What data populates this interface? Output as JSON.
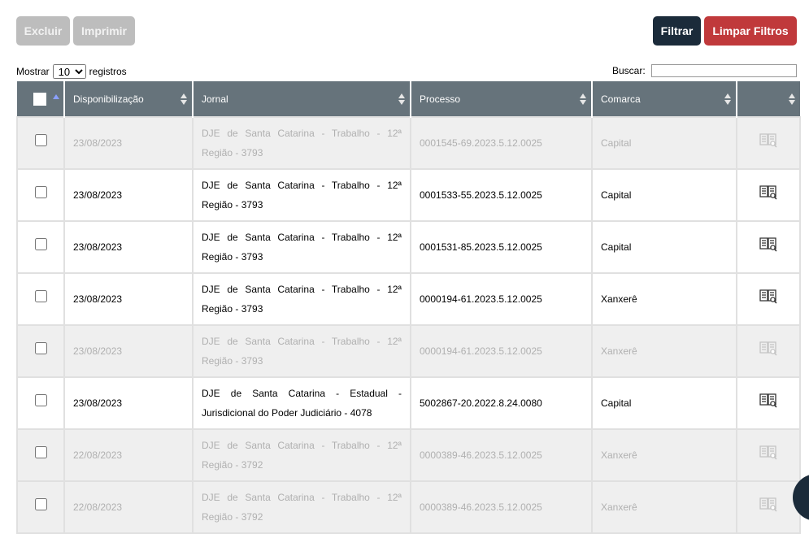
{
  "toolbar": {
    "excluir": "Excluir",
    "imprimir": "Imprimir",
    "filtrar": "Filtrar",
    "limpar": "Limpar Filtros"
  },
  "length": {
    "prefix": "Mostrar",
    "value": "10",
    "suffix": "registros"
  },
  "search": {
    "label": "Buscar:",
    "value": ""
  },
  "table": {
    "headers": [
      "",
      "Disponibilização",
      "Jornal",
      "Processo",
      "Comarca",
      ""
    ],
    "rows": [
      {
        "date": "23/08/2023",
        "jornal": "DJE de Santa Catarina - Trabalho - 12ª Região - 3793",
        "processo": "0001545-69.2023.5.12.0025",
        "comarca": "Capital",
        "dim": true
      },
      {
        "date": "23/08/2023",
        "jornal": "DJE de Santa Catarina - Trabalho - 12ª Região - 3793",
        "processo": "0001533-55.2023.5.12.0025",
        "comarca": "Capital",
        "dim": false
      },
      {
        "date": "23/08/2023",
        "jornal": "DJE de Santa Catarina - Trabalho - 12ª Região - 3793",
        "processo": "0001531-85.2023.5.12.0025",
        "comarca": "Capital",
        "dim": false
      },
      {
        "date": "23/08/2023",
        "jornal": "DJE de Santa Catarina - Trabalho - 12ª Região - 3793",
        "processo": "0000194-61.2023.5.12.0025",
        "comarca": "Xanxerê",
        "dim": false
      },
      {
        "date": "23/08/2023",
        "jornal": "DJE de Santa Catarina - Trabalho - 12ª Região - 3793",
        "processo": "0000194-61.2023.5.12.0025",
        "comarca": "Xanxerê",
        "dim": true
      },
      {
        "date": "23/08/2023",
        "jornal": "DJE de Santa Catarina - Estadual - Jurisdicional do Poder Judiciário - 4078",
        "processo": "5002867-20.2022.8.24.0080",
        "comarca": "Capital",
        "dim": false
      },
      {
        "date": "22/08/2023",
        "jornal": "DJE de Santa Catarina - Trabalho - 12ª Região - 3792",
        "processo": "0000389-46.2023.5.12.0025",
        "comarca": "Xanxerê",
        "dim": true
      },
      {
        "date": "22/08/2023",
        "jornal": "DJE de Santa Catarina - Trabalho - 12ª Região - 3792",
        "processo": "0000389-46.2023.5.12.0025",
        "comarca": "Xanxerê",
        "dim": true
      }
    ]
  },
  "colors": {
    "header_bg": "#66737b",
    "filtrar_bg": "#1b2b3a",
    "limpar_bg": "#c0393b",
    "disabled_bg": "#bdbdbd",
    "dim_row_bg": "#efefef"
  },
  "icons": {
    "action": "book-search-icon",
    "chat": "chat-bubble-icon"
  }
}
